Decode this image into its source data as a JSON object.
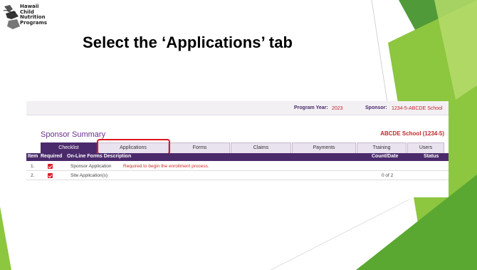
{
  "logo": {
    "line1": "Hawaii",
    "line2": "Child",
    "line3": "Nutrition",
    "line4": "Programs",
    "icon": "hawaii-islands-icon"
  },
  "slide": {
    "title": "Select the ‘Applications’ tab",
    "accent_color": "#8dc63f"
  },
  "app": {
    "program_year_label": "Program Year:",
    "program_year": "2023",
    "sponsor_label": "Sponsor:",
    "sponsor_value": "1234-5-ABCDE School",
    "summary_title": "Sponsor Summary",
    "school_name": "ABCDE School (1234-5)",
    "tabs": [
      {
        "label": "Checklist"
      },
      {
        "label": "Applications"
      },
      {
        "label": "Forms"
      },
      {
        "label": "Claims"
      },
      {
        "label": "Payments"
      },
      {
        "label": "Training"
      },
      {
        "label": "Users"
      }
    ],
    "table": {
      "headers": {
        "item": "Item",
        "required": "Required",
        "description": "On-Line Forms Description",
        "count": "Count/Date",
        "status": "Status"
      },
      "rows": [
        {
          "item": "1.",
          "form": "Sponsor Application",
          "note": "Required to begin the enrollment process.",
          "count": ""
        },
        {
          "item": "2.",
          "form": "Site Application(s)",
          "note": "",
          "count": "0 of 2"
        }
      ]
    },
    "colors": {
      "purple": "#4b2a6c",
      "red": "#c0262c",
      "tab_bg": "#e9e2ef"
    }
  }
}
